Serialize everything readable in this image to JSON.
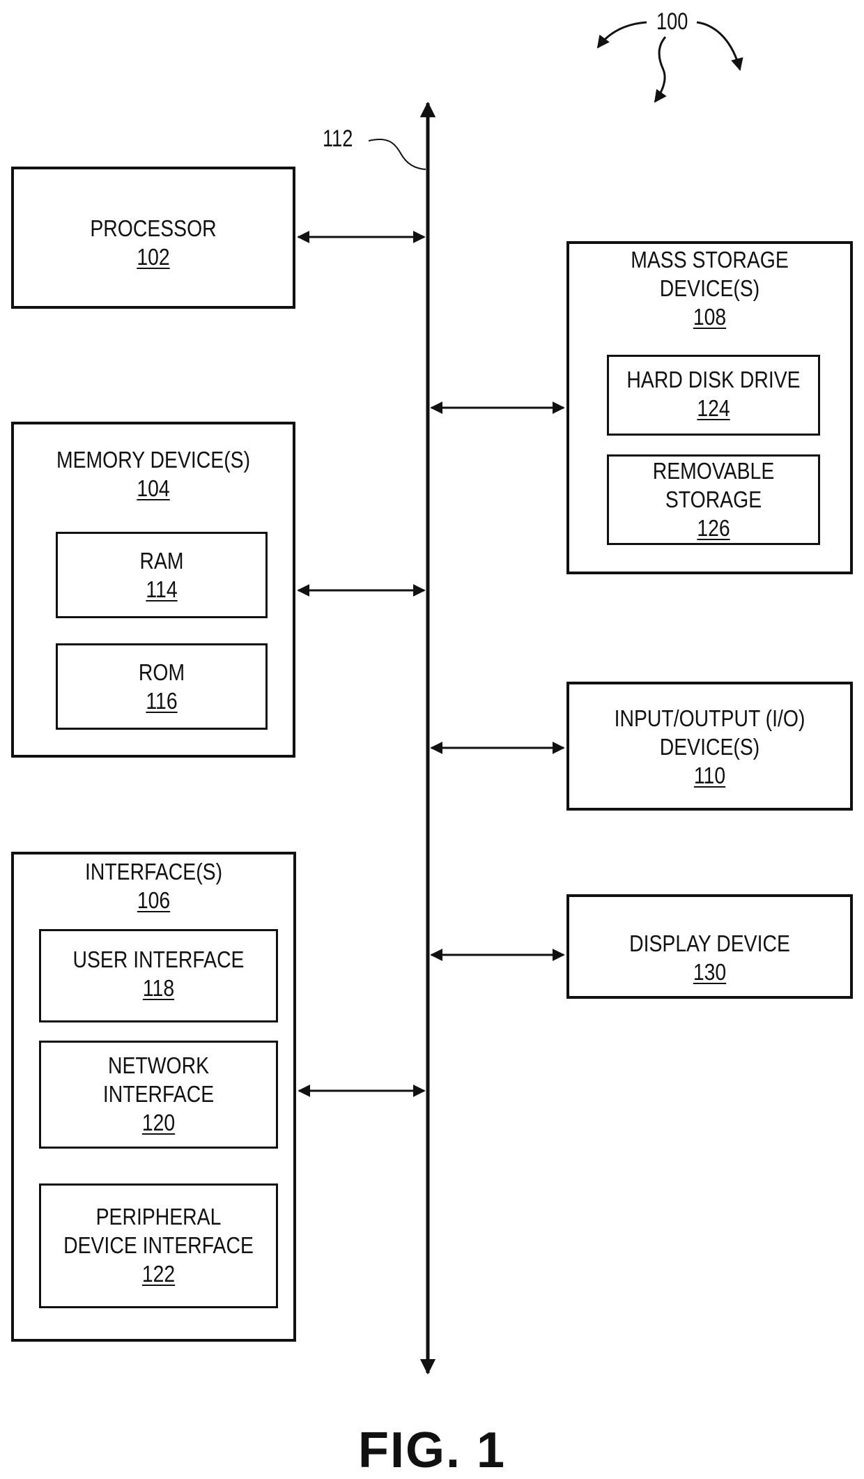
{
  "figure": {
    "title": "FIG. 1",
    "system_ref": "100",
    "bus_ref": "112"
  },
  "components": {
    "processor": {
      "lines": [
        "PROCESSOR"
      ],
      "ref": "102"
    },
    "memory": {
      "lines": [
        "MEMORY DEVICE(S)"
      ],
      "ref": "104",
      "children": {
        "ram": {
          "lines": [
            "RAM"
          ],
          "ref": "114"
        },
        "rom": {
          "lines": [
            "ROM"
          ],
          "ref": "116"
        }
      }
    },
    "interfaces": {
      "lines": [
        "INTERFACE(S)"
      ],
      "ref": "106",
      "children": {
        "user_interface": {
          "lines": [
            "USER INTERFACE"
          ],
          "ref": "118"
        },
        "network_interface": {
          "lines": [
            "NETWORK",
            "INTERFACE"
          ],
          "ref": "120"
        },
        "peripheral_interface": {
          "lines": [
            "PERIPHERAL",
            "DEVICE INTERFACE"
          ],
          "ref": "122"
        }
      }
    },
    "mass_storage": {
      "lines": [
        "MASS STORAGE",
        "DEVICE(S)"
      ],
      "ref": "108",
      "children": {
        "hard_disk": {
          "lines": [
            "HARD DISK DRIVE"
          ],
          "ref": "124"
        },
        "removable": {
          "lines": [
            "REMOVABLE",
            "STORAGE"
          ],
          "ref": "126"
        }
      }
    },
    "io": {
      "lines": [
        "INPUT/OUTPUT (I/O)",
        "DEVICE(S)"
      ],
      "ref": "110"
    },
    "display": {
      "lines": [
        "DISPLAY DEVICE"
      ],
      "ref": "130"
    }
  },
  "connections": [
    {
      "from": "processor",
      "to": "bus",
      "direction": "bidirectional"
    },
    {
      "from": "memory",
      "to": "bus",
      "direction": "bidirectional"
    },
    {
      "from": "interfaces",
      "to": "bus",
      "direction": "bidirectional"
    },
    {
      "from": "bus",
      "to": "mass_storage",
      "direction": "bidirectional"
    },
    {
      "from": "bus",
      "to": "io",
      "direction": "bidirectional"
    },
    {
      "from": "bus",
      "to": "display",
      "direction": "bidirectional"
    }
  ]
}
